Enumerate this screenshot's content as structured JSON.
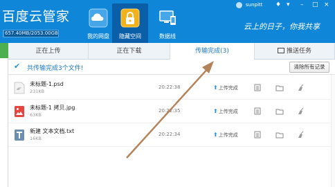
{
  "header": {
    "app_title": "百度云管家",
    "quota": "657.40MB/2053.00GB",
    "quota_fraction": 0.0003,
    "nav": [
      {
        "label": "我的网盘",
        "icon": "cloud-drive-icon"
      },
      {
        "label": "隐藏空间",
        "icon": "lock-icon"
      },
      {
        "label": "数据线",
        "icon": "monitor-phone-icon"
      }
    ],
    "user": "sunpitt",
    "slogan": "云上的日子，你我共享"
  },
  "tabs": [
    {
      "label": "正在上传"
    },
    {
      "label": "正在下载"
    },
    {
      "label": "传输完成(3)"
    },
    {
      "label": "推送任务"
    }
  ],
  "summary": {
    "text": "共传输完成3个文件!",
    "clear_label": "清除所有记录"
  },
  "files": [
    {
      "name": "未标题-1.psd",
      "size": "231KB",
      "time": "20:22:38",
      "status": "上传完成",
      "icon": "psd-file-icon"
    },
    {
      "name": "未标题-1 拷贝.jpg",
      "size": "63KB",
      "time": "20:22:35",
      "status": "上传完成",
      "icon": "image-file-icon"
    },
    {
      "name": "新建 文本文档.txt",
      "size": "16KB",
      "time": "20:22:34",
      "status": "上传完成",
      "icon": "text-file-icon"
    }
  ],
  "colors": {
    "header_blue": "#0f86d8",
    "active_nav": "#0a5fa8",
    "accent_text": "#1a78c2",
    "annotation_arrow": "#b5835a"
  }
}
